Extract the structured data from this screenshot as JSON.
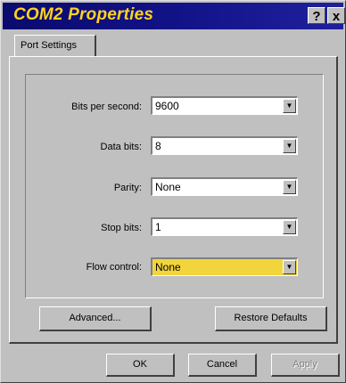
{
  "window": {
    "title": "COM2 Properties"
  },
  "titlebar": {
    "help_label": "?",
    "close_label": "x"
  },
  "tabs": [
    {
      "label": "Port Settings"
    }
  ],
  "fields": [
    {
      "label": "Bits per second:",
      "value": "9600"
    },
    {
      "label": "Data bits:",
      "value": "8"
    },
    {
      "label": "Parity:",
      "value": "None"
    },
    {
      "label": "Stop bits:",
      "value": "1"
    },
    {
      "label": "Flow control:",
      "value": "None"
    }
  ],
  "buttons": {
    "advanced": "Advanced...",
    "restore": "Restore Defaults",
    "ok": "OK",
    "cancel": "Cancel",
    "apply": "Apply"
  },
  "colors": {
    "titlebar": "#13138a",
    "title_text": "#ffd21f",
    "highlight": "#f2d53c"
  }
}
